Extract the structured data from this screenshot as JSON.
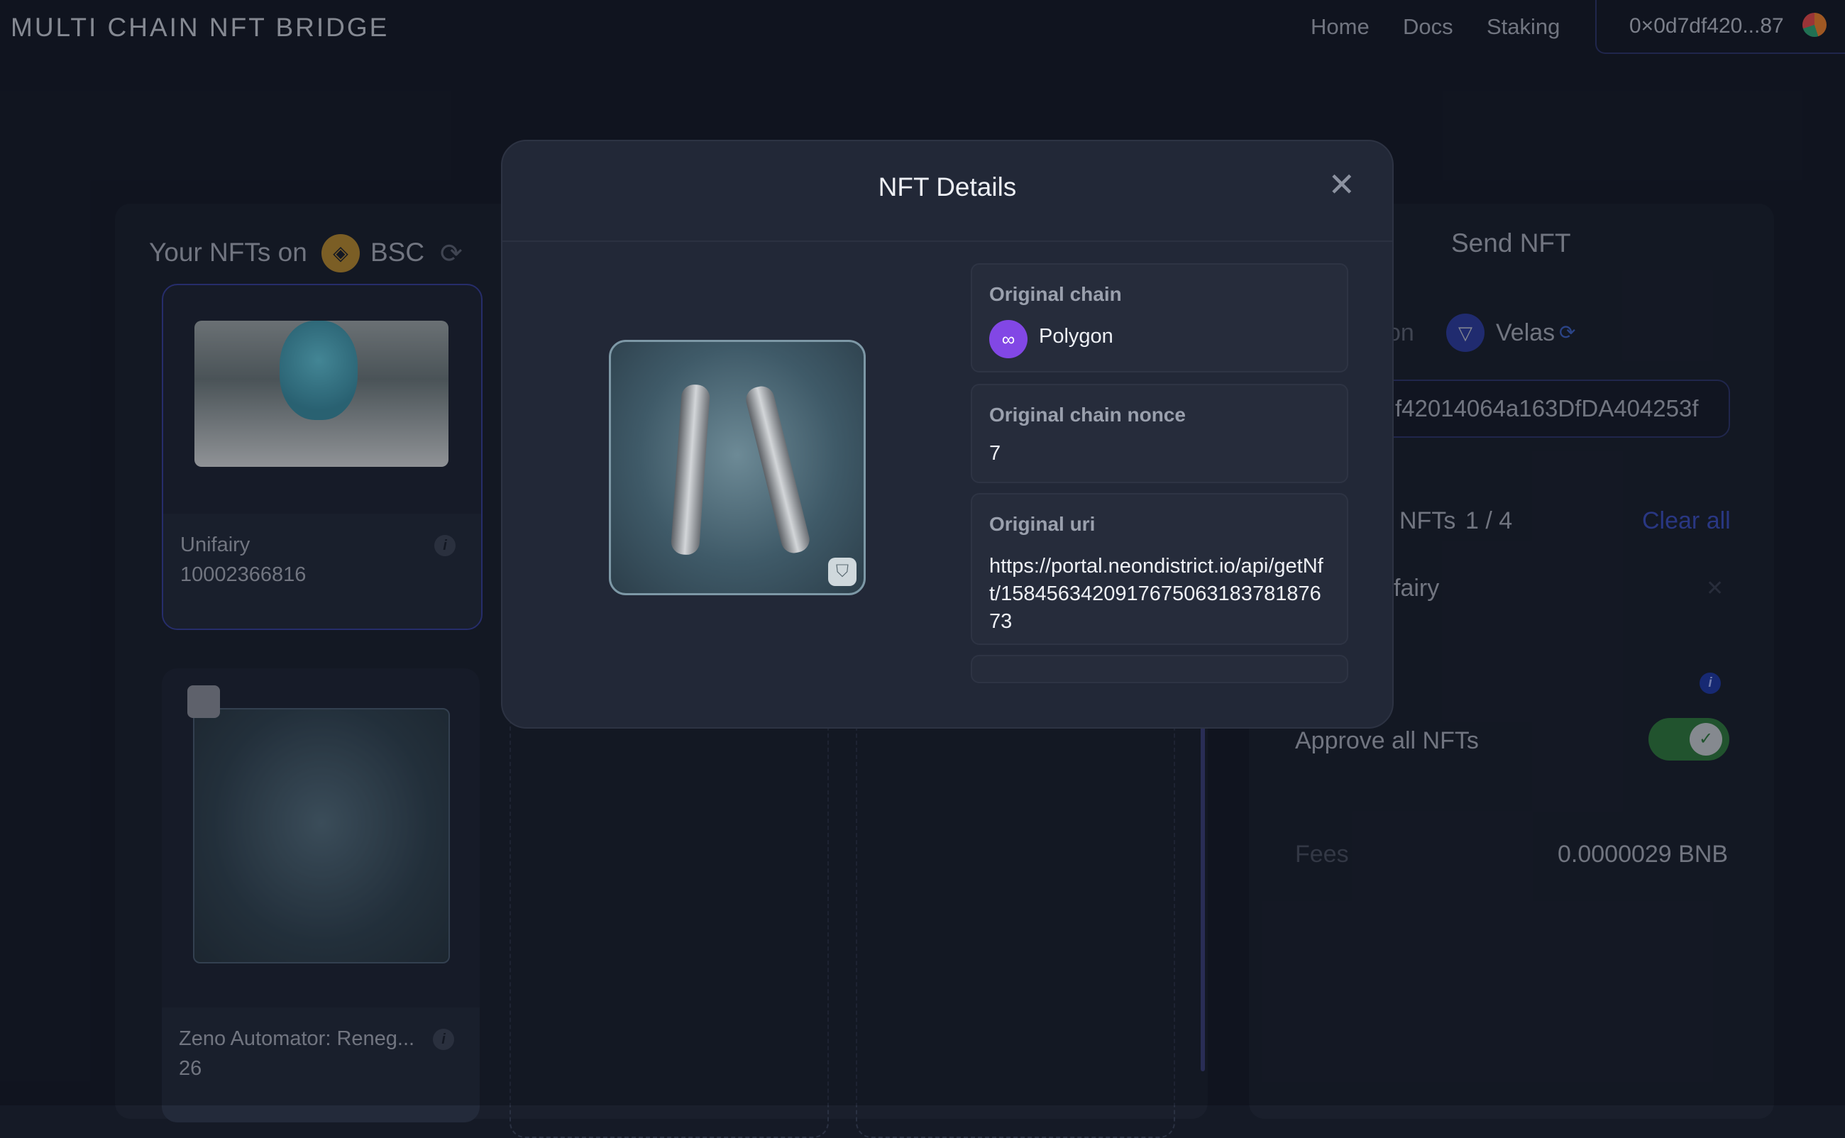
{
  "header": {
    "logo": "MULTI CHAIN NFT BRIDGE",
    "nav": [
      "Home",
      "Docs",
      "Staking"
    ],
    "wallet_address": "0×0d7df420...87"
  },
  "nft_panel": {
    "title": "Your NFTs on",
    "chain": "BSC",
    "chain_icon": "bsc-icon",
    "cards": [
      {
        "name": "Unifairy",
        "id": "10002366816"
      },
      {
        "name": "Zeno Automator: Reneg...",
        "id": "26"
      }
    ]
  },
  "send_panel": {
    "title": "Send NFT",
    "destination_label": "on",
    "destination_chain": "Velas",
    "address_value": "f42014064a163DfDA404253f",
    "selected_label": "NFTs",
    "selected_count": "1 / 4",
    "clear_all": "Clear all",
    "selected_item": "fairy",
    "approve_label": "Approve all NFTs",
    "approve_enabled": true,
    "fees_label": "Fees",
    "fees_value": "0.0000029 BNB"
  },
  "modal": {
    "title": "NFT Details",
    "details": [
      {
        "label": "Original chain",
        "value": "Polygon"
      },
      {
        "label": "Original chain nonce",
        "value": "7"
      },
      {
        "label": "Original uri",
        "value": "https://portal.neondistrict.io/api/getNft/158456342091767506318378187673"
      }
    ]
  },
  "colors": {
    "background": "#151a26",
    "accent_blue": "#3b4fbf",
    "toggle_green": "#2f7a3c",
    "polygon_purple": "#8247e5",
    "bsc_gold": "#b98a2e"
  }
}
